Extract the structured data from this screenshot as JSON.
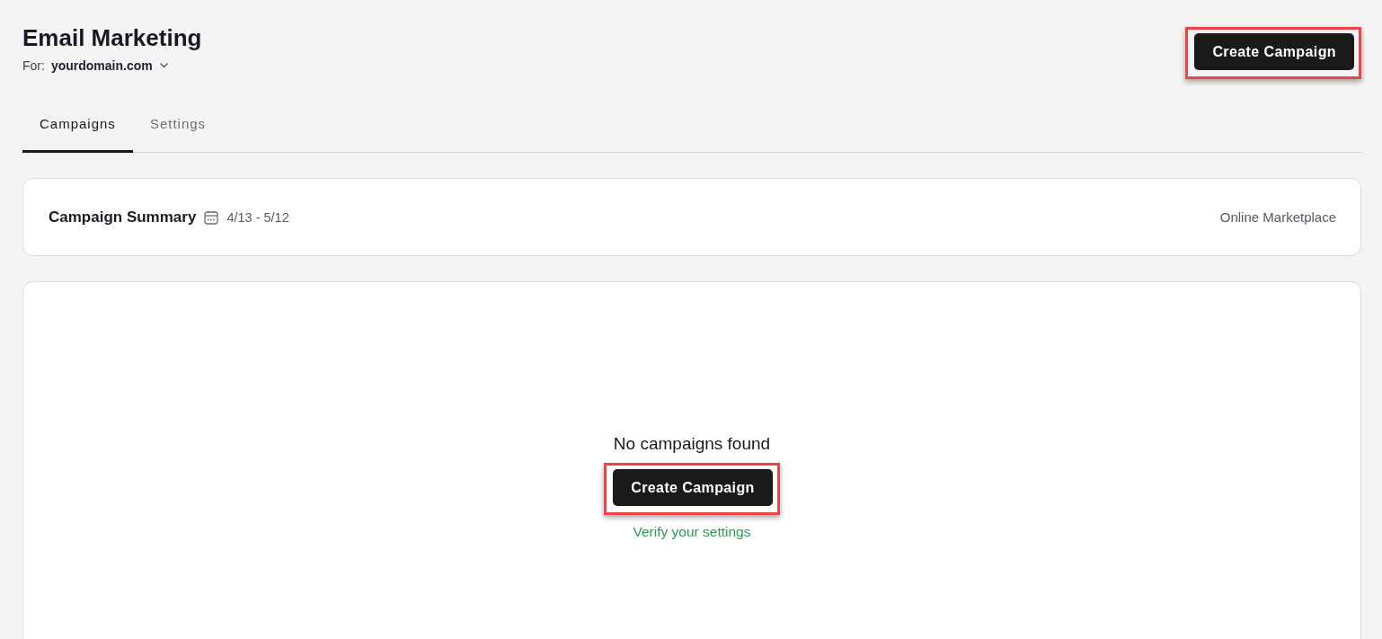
{
  "header": {
    "title": "Email Marketing",
    "for_label": "For:",
    "domain": "yourdomain.com",
    "create_button": {
      "label": "Create Campaign",
      "highlighted": true
    }
  },
  "tabs": [
    {
      "label": "Campaigns",
      "selected": true
    },
    {
      "label": "Settings",
      "selected": false
    }
  ],
  "summary": {
    "title": "Campaign Summary",
    "date_range": "4/13 - 5/12",
    "store": "Online Marketplace"
  },
  "empty_state": {
    "message": "No campaigns found",
    "create_button": {
      "label": "Create Campaign",
      "highlighted": true
    },
    "link": "Verify your settings"
  }
}
